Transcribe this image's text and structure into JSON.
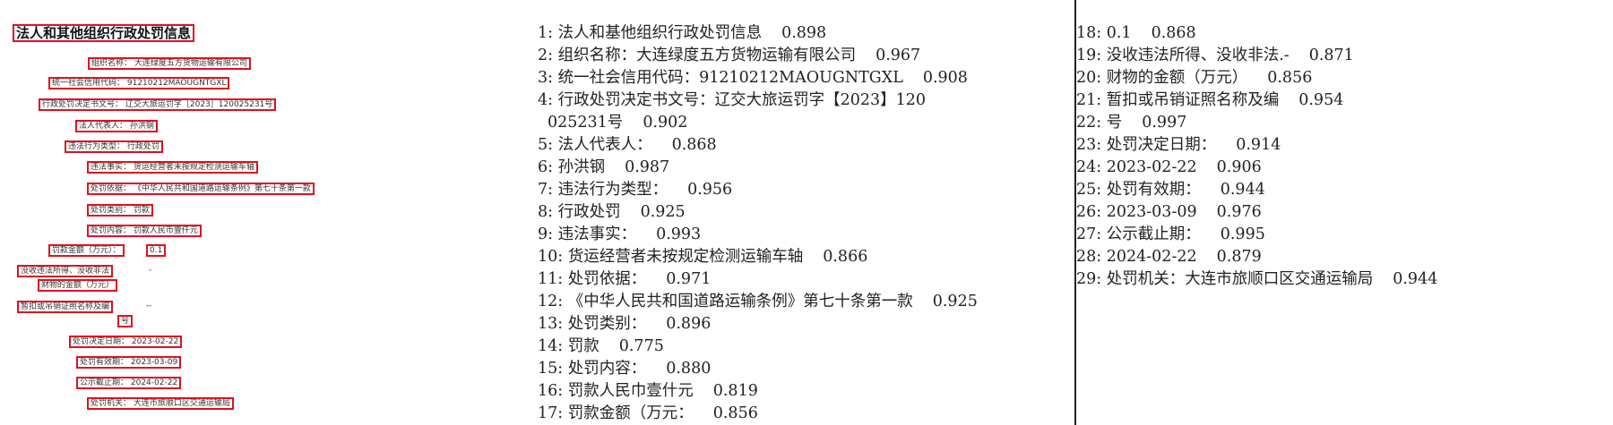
{
  "source_document": {
    "title": "法人和其他组织行政处罚信息",
    "fields": [
      {
        "key": "org_name",
        "text": "组织名称：  大连绿度五方货物运输有限公司"
      },
      {
        "key": "credit_code",
        "text": "统一社会信用代码：  91210212MAOUGNTGXL"
      },
      {
        "key": "decision_no",
        "text": "行政处罚决定书文号：  辽交大旅运罚字［2023］120025231号"
      },
      {
        "key": "legal_rep",
        "text": "法人代表人：  孙洪钢"
      },
      {
        "key": "violation_type",
        "text": "违法行为类型：  行政处罚"
      },
      {
        "key": "facts",
        "text": "违法事实：  货运经营者未按规定检测运输车轴"
      },
      {
        "key": "basis",
        "text": "处罚依据：  《中华人民共和国道路运输条例》第七十条第一款"
      },
      {
        "key": "category",
        "text": "处罚类别：  罚款"
      },
      {
        "key": "content",
        "text": "处罚内容：  罚款人民币壹仟元"
      },
      {
        "key": "fine_amount_label",
        "text": "罚款金额（万元）："
      },
      {
        "key": "fine_amount_value",
        "text": "0.1"
      },
      {
        "key": "confiscation_label",
        "text": "没收违法所得、没收非法"
      },
      {
        "key": "confiscation_value",
        "text": "-"
      },
      {
        "key": "property_label",
        "text": "财物的金额（万元）"
      },
      {
        "key": "license_label",
        "text": "暂扣或吊销证照名称及编"
      },
      {
        "key": "license_value",
        "text": "--"
      },
      {
        "key": "license_suffix",
        "text": "号"
      },
      {
        "key": "decision_date",
        "text": "处罚决定日期：  2023-02-22"
      },
      {
        "key": "valid_until",
        "text": "处罚有效期：  2023-03-09"
      },
      {
        "key": "publish_until",
        "text": "公示截止期：  2024-02-22"
      },
      {
        "key": "authority",
        "text": "处罚机关：  大连市旅顺口区交通运输局"
      }
    ]
  },
  "ocr_results_col1": [
    {
      "text": "1: 法人和基他组织行政处罚信息",
      "score": "0.898"
    },
    {
      "text": "2: 组织名称：大连绿度五方货物运输有限公司",
      "score": "0.967"
    },
    {
      "text": "3: 统一社会信用代码：91210212MAOUGNTGXL",
      "score": "0.908"
    },
    {
      "text": "4: 行政处罚决定书文号：辽交大旅运罚字【2023】120",
      "score": ""
    },
    {
      "text": "025231号",
      "score": "0.902",
      "cont": true
    },
    {
      "text": "5: 法人代表人：",
      "score": "0.868"
    },
    {
      "text": "6: 孙洪钢",
      "score": "0.987"
    },
    {
      "text": "7: 违法行为类型：",
      "score": "0.956"
    },
    {
      "text": "8: 行政处罚",
      "score": "0.925"
    },
    {
      "text": "9: 违法事实：",
      "score": "0.993"
    },
    {
      "text": "10: 货运经营者未按规定检测运输车轴",
      "score": "0.866"
    },
    {
      "text": "11: 处罚依据：",
      "score": "0.971"
    },
    {
      "text": "12: 《中华人民共和国道路运输条例》第七十条第一款",
      "score": "0.925"
    },
    {
      "text": "13: 处罚类别：",
      "score": "0.896"
    },
    {
      "text": "14: 罚款",
      "score": "0.775"
    },
    {
      "text": "15: 处罚内容：",
      "score": "0.880"
    },
    {
      "text": "16: 罚款人民巾壹什元",
      "score": "0.819"
    },
    {
      "text": "17: 罚款金额（万元：",
      "score": "0.856"
    }
  ],
  "ocr_results_col2": [
    {
      "text": "18: 0.1",
      "score": "0.868"
    },
    {
      "text": "19: 没收违法所得、没收非法.-",
      "score": "0.871"
    },
    {
      "text": "20: 财物的金额（万元）",
      "score": "0.856"
    },
    {
      "text": "21: 暂扣或吊销证照名称及编",
      "score": "0.954"
    },
    {
      "text": "22: 号",
      "score": "0.997"
    },
    {
      "text": "23: 处罚决定日期：",
      "score": "0.914"
    },
    {
      "text": "24: 2023-02-22",
      "score": "0.906"
    },
    {
      "text": "25: 处罚有效期：",
      "score": "0.944"
    },
    {
      "text": "26: 2023-03-09",
      "score": "0.976"
    },
    {
      "text": "27: 公示截止期：",
      "score": "0.995"
    },
    {
      "text": "28: 2024-02-22",
      "score": "0.879"
    },
    {
      "text": "29: 处罚机关：大连市旅顺口区交通运输局",
      "score": "0.944"
    }
  ],
  "colors": {
    "box_outline": "#e01020",
    "text": "#222222",
    "background": "#ffffff"
  }
}
